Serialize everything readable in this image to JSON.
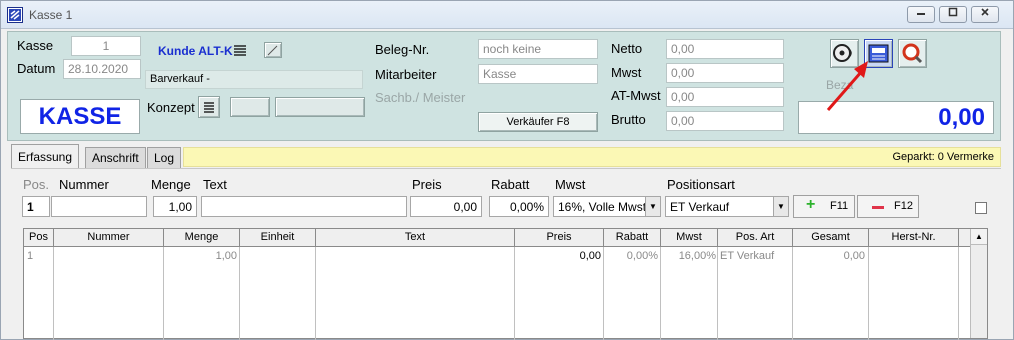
{
  "window": {
    "title": "Kasse 1"
  },
  "header": {
    "kasse_label": "Kasse",
    "kasse_value": "1",
    "datum_label": "Datum",
    "datum_value": "28.10.2020",
    "kasse_big": "KASSE",
    "kunde_label": "Kunde ALT-K",
    "barverkauf": "Barverkauf -",
    "konzept_label": "Konzept",
    "beleg_label": "Beleg-Nr.",
    "beleg_value": "noch keine",
    "mitarbeiter_label": "Mitarbeiter",
    "mitarbeiter_value": "Kasse",
    "sachb_label": "Sachb./ Meister",
    "verkaeufer_button": "Verkäufer F8",
    "netto_label": "Netto",
    "netto_value": "0,00",
    "mwst_label": "Mwst",
    "mwst_value": "0,00",
    "atmwst_label": "AT-Mwst",
    "atmwst_value": "0,00",
    "brutto_label": "Brutto",
    "brutto_value": "0,00",
    "bezahlt_label": "Beza",
    "total": "0,00"
  },
  "tabs": [
    "Erfassung",
    "Anschrift",
    "Log"
  ],
  "geparkt": "Geparkt: 0 Vermerke",
  "entry": {
    "pos_label": "Pos.",
    "nummer_label": "Nummer",
    "menge_label": "Menge",
    "text_label": "Text",
    "preis_label": "Preis",
    "rabatt_label": "Rabatt",
    "mwst_label": "Mwst",
    "positionsart_label": "Positionsart",
    "pos_value": "1",
    "nummer_value": "",
    "menge_value": "1,00",
    "text_value": "",
    "preis_value": "0,00",
    "rabatt_value": "0,00%",
    "mwst_value": "16%, Volle Mwst",
    "positionsart_value": "ET Verkauf",
    "f11_label": "F11",
    "f12_label": "F12"
  },
  "table": {
    "columns": [
      "Pos",
      "Nummer",
      "Menge",
      "Einheit",
      "Text",
      "Preis",
      "Rabatt",
      "Mwst",
      "Pos. Art",
      "Gesamt",
      "Herst-Nr."
    ],
    "rows": [
      {
        "pos": "1",
        "nummer": "",
        "menge": "1,00",
        "einheit": "",
        "text": "",
        "preis": "0,00",
        "rabatt": "0,00%",
        "mwst": "16,00%",
        "posart": "ET Verkauf",
        "gesamt": "0,00",
        "herst": ""
      }
    ]
  },
  "colors": {
    "header_bg": "#cfe3e1",
    "accent_blue": "#1024e6",
    "arrow_red": "#e01818",
    "geparkt_bg": "#fbf8b5"
  }
}
